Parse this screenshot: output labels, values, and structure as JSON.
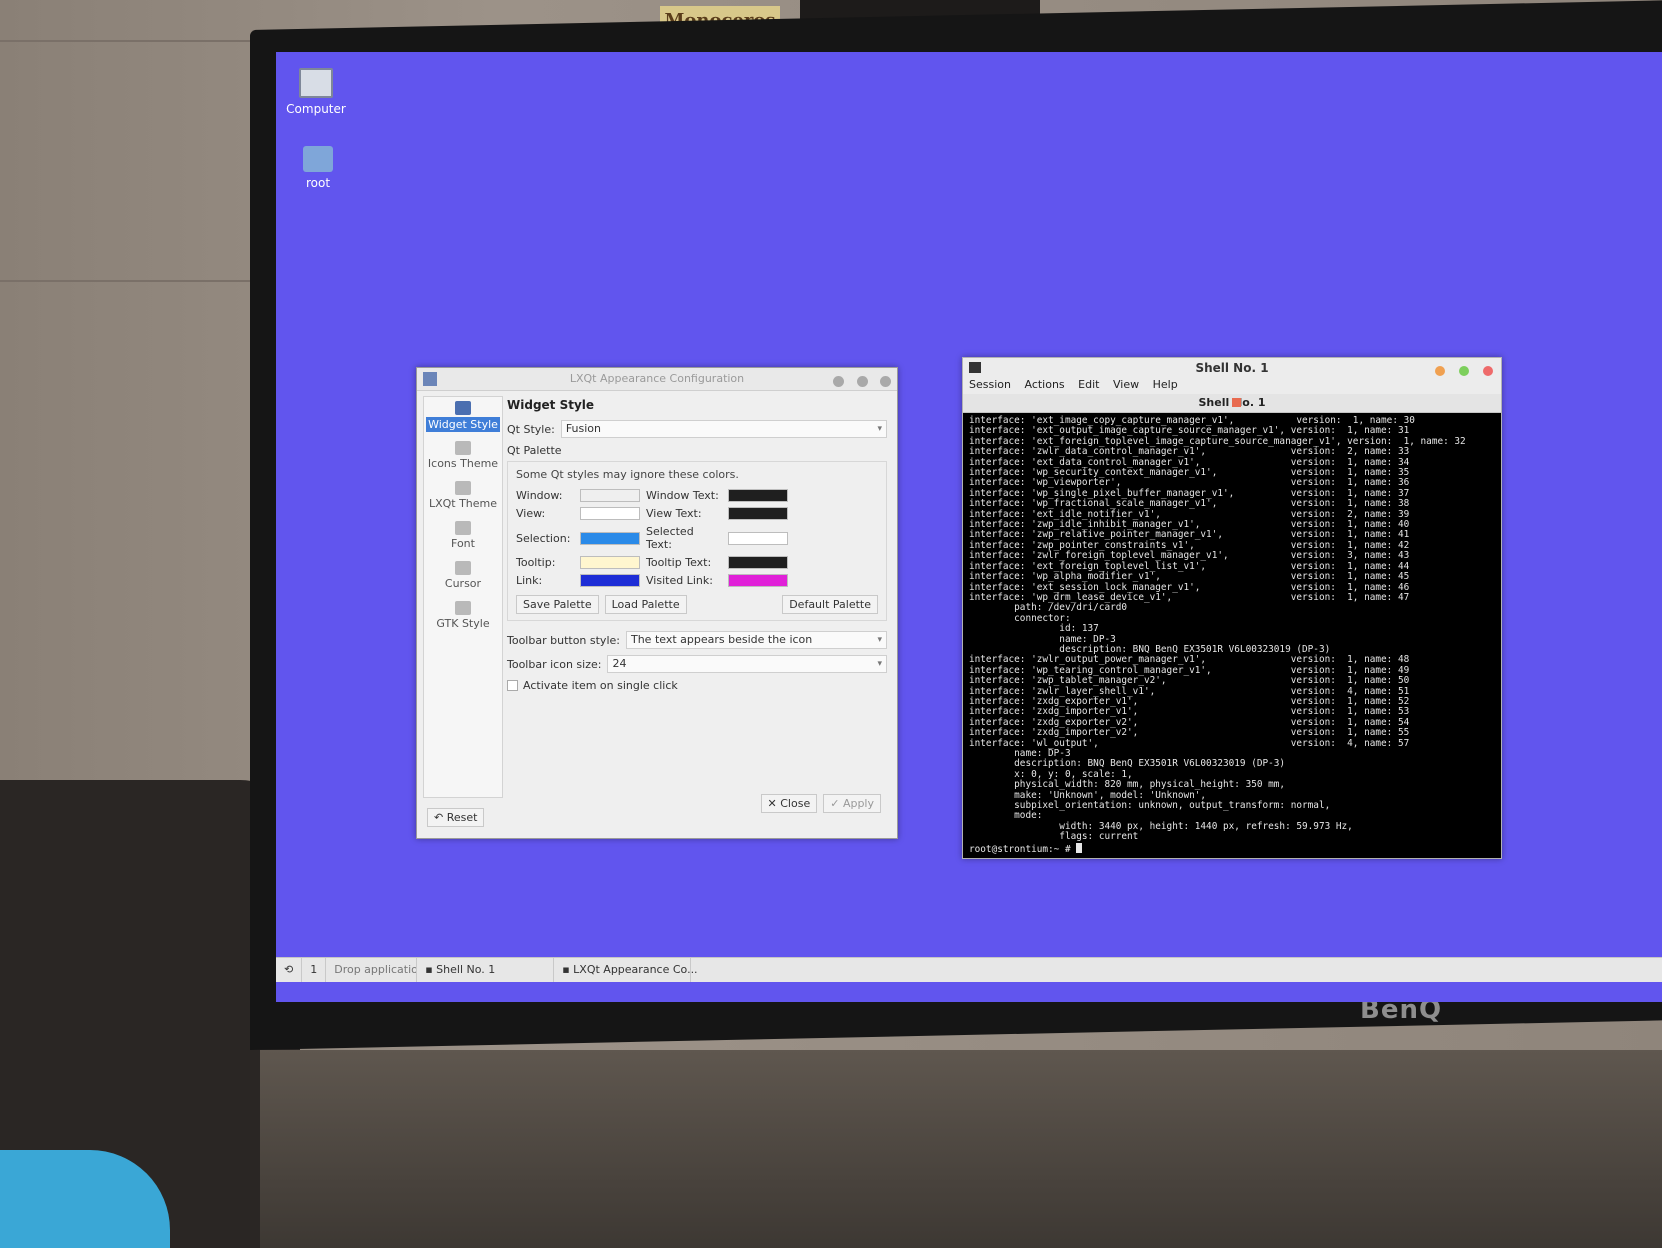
{
  "environment": {
    "top_sticker": "Monoceros",
    "monitor_brand": "BenQ"
  },
  "desktop": {
    "icons": [
      {
        "label": "Computer",
        "icon": "computer-icon"
      },
      {
        "label": "root",
        "icon": "home-folder-icon"
      }
    ],
    "background_color": "#6155ee"
  },
  "appearance_window": {
    "title": "LXQt Appearance Configuration",
    "sidebar": [
      {
        "label": "Widget Style",
        "icon": "widget-style-icon",
        "active": true
      },
      {
        "label": "Icons Theme",
        "icon": "icons-theme-icon"
      },
      {
        "label": "LXQt Theme",
        "icon": "lxqt-theme-icon"
      },
      {
        "label": "Font",
        "icon": "font-icon"
      },
      {
        "label": "Cursor",
        "icon": "cursor-icon"
      },
      {
        "label": "GTK Style",
        "icon": "gtk-style-icon"
      }
    ],
    "section_title": "Widget Style",
    "qt_style_label": "Qt Style:",
    "qt_style_value": "Fusion",
    "palette_group": "Qt Palette",
    "palette_note": "Some Qt styles may ignore these colors.",
    "palette": [
      {
        "label": "Window:",
        "color": "#efefef",
        "text_label": "Window Text:",
        "text_color": "#1f1f1f"
      },
      {
        "label": "View:",
        "color": "#ffffff",
        "text_label": "View Text:",
        "text_color": "#1f1f1f"
      },
      {
        "label": "Selection:",
        "color": "#2a8ae8",
        "text_label": "Selected Text:",
        "text_color": "#ffffff"
      },
      {
        "label": "Tooltip:",
        "color": "#fff6cf",
        "text_label": "Tooltip Text:",
        "text_color": "#1f1f1f"
      },
      {
        "label": "Link:",
        "color": "#1d2dd6",
        "text_label": "Visited Link:",
        "text_color": "#e020d8"
      }
    ],
    "buttons": {
      "save_palette": "Save Palette",
      "load_palette": "Load Palette",
      "default_palette": "Default Palette",
      "reset": "Reset",
      "close": "Close",
      "apply": "Apply"
    },
    "toolbar_button_style_label": "Toolbar button style:",
    "toolbar_button_style_value": "The text appears beside the icon",
    "toolbar_icon_size_label": "Toolbar icon size:",
    "toolbar_icon_size_value": "24",
    "single_click_label": "Activate item on single click"
  },
  "terminal": {
    "title": "Shell No. 1",
    "menu": [
      "Session",
      "Actions",
      "Edit",
      "View",
      "Help"
    ],
    "tab_label": "Shell No. 1",
    "lines": [
      "interface: 'ext_image_copy_capture_manager_v1',           version:  1, name: 30",
      "interface: 'ext_output_image_capture_source_manager_v1', version:  1, name: 31",
      "interface: 'ext_foreign_toplevel_image_capture_source_manager_v1', version:  1, name: 32",
      "interface: 'zwlr_data_control_manager_v1',               version:  2, name: 33",
      "interface: 'ext_data_control_manager_v1',                version:  1, name: 34",
      "interface: 'wp_security_context_manager_v1',             version:  1, name: 35",
      "interface: 'wp_viewporter',                              version:  1, name: 36",
      "interface: 'wp_single_pixel_buffer_manager_v1',          version:  1, name: 37",
      "interface: 'wp_fractional_scale_manager_v1',             version:  1, name: 38",
      "interface: 'ext_idle_notifier_v1',                       version:  2, name: 39",
      "interface: 'zwp_idle_inhibit_manager_v1',                version:  1, name: 40",
      "interface: 'zwp_relative_pointer_manager_v1',            version:  1, name: 41",
      "interface: 'zwp_pointer_constraints_v1',                 version:  1, name: 42",
      "interface: 'zwlr_foreign_toplevel_manager_v1',           version:  3, name: 43",
      "interface: 'ext_foreign_toplevel_list_v1',               version:  1, name: 44",
      "interface: 'wp_alpha_modifier_v1',                       version:  1, name: 45",
      "interface: 'ext_session_lock_manager_v1',                version:  1, name: 46",
      "interface: 'wp_drm_lease_device_v1',                     version:  1, name: 47",
      "        path: /dev/dri/card0",
      "        connector:",
      "                id: 137",
      "                name: DP-3",
      "                description: BNQ BenQ EX3501R V6L00323019 (DP-3)",
      "interface: 'zwlr_output_power_manager_v1',               version:  1, name: 48",
      "interface: 'wp_tearing_control_manager_v1',              version:  1, name: 49",
      "interface: 'zwp_tablet_manager_v2',                      version:  1, name: 50",
      "interface: 'zwlr_layer_shell_v1',                        version:  4, name: 51",
      "interface: 'zxdg_exporter_v1',                           version:  1, name: 52",
      "interface: 'zxdg_importer_v1',                           version:  1, name: 53",
      "interface: 'zxdg_exporter_v2',                           version:  1, name: 54",
      "interface: 'zxdg_importer_v2',                           version:  1, name: 55",
      "interface: 'wl_output',                                  version:  4, name: 57",
      "        name: DP-3",
      "        description: BNQ BenQ EX3501R V6L00323019 (DP-3)",
      "        x: 0, y: 0, scale: 1,",
      "        physical_width: 820 mm, physical_height: 350 mm,",
      "        make: 'Unknown', model: 'Unknown',",
      "        subpixel_orientation: unknown, output_transform: normal,",
      "        mode:",
      "                width: 3440 px, height: 1440 px, refresh: 59.973 Hz,",
      "                flags: current"
    ],
    "prompt": "root@strontium:~ # "
  },
  "taskbar": {
    "desktop_number": "1",
    "quicklaunch_hint": "Drop application icons here",
    "tasks": [
      "Shell No. 1",
      "LXQt Appearance Co..."
    ]
  }
}
